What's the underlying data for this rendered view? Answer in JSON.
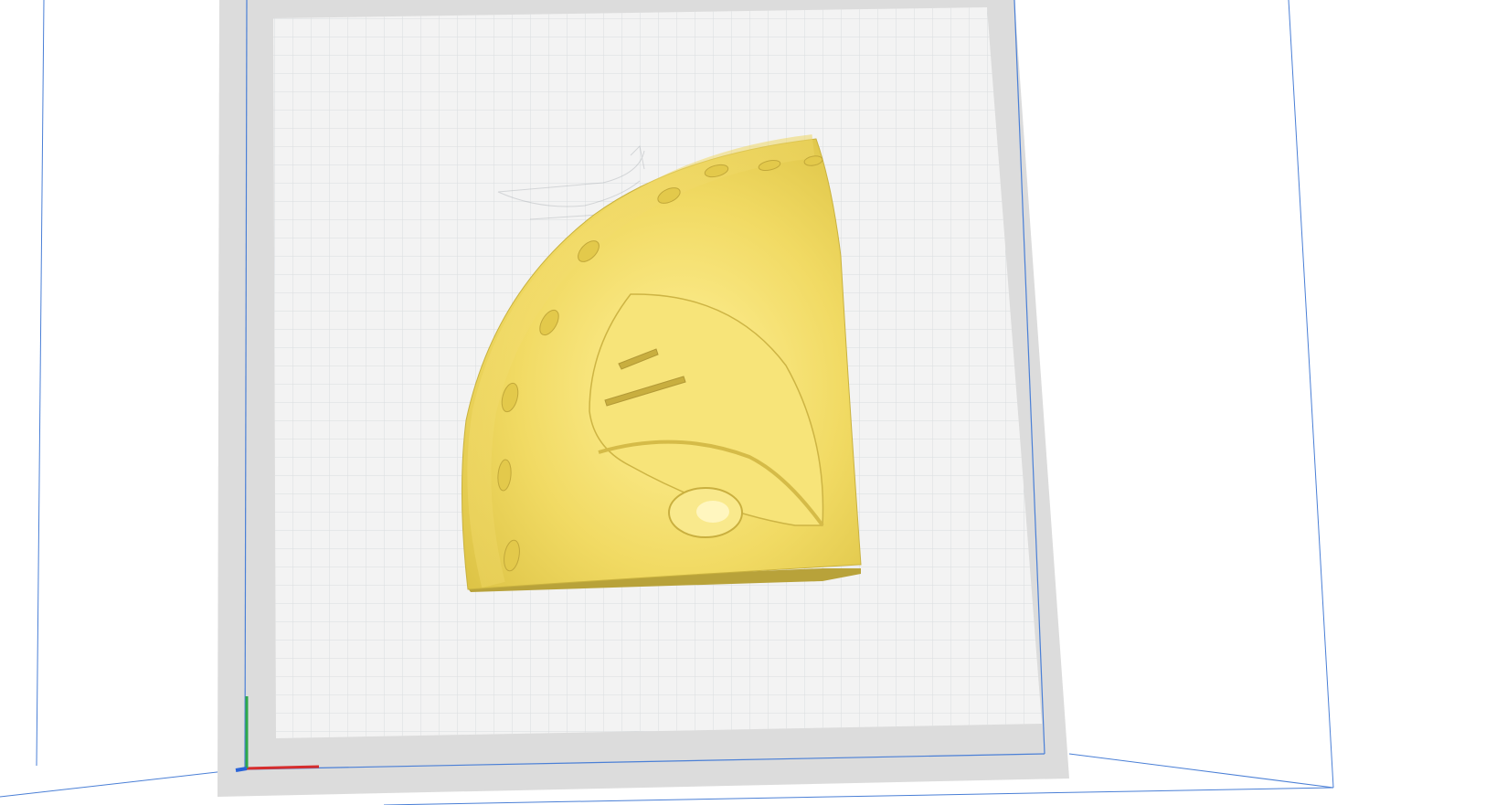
{
  "app": {
    "view": "3d-build-plate-viewport"
  },
  "scene": {
    "background_color": "#ffffff",
    "plate_color": "#f3f3f3",
    "plate_border_color": "#dcdcdc",
    "grid_color": "#d6dadd",
    "volume_edge_color": "#4a7fd6",
    "model_color": "#f2dd6b",
    "model_shadow_color": "#c9b23f",
    "axis_x_color": "#d62d2d",
    "axis_y_color": "#2ea84a",
    "axis_z_color": "#2a64d8"
  },
  "model": {
    "name": "helmet-quarter-shell",
    "selected": false
  },
  "axes": [
    {
      "name": "x-axis"
    },
    {
      "name": "y-axis"
    },
    {
      "name": "z-axis"
    }
  ]
}
